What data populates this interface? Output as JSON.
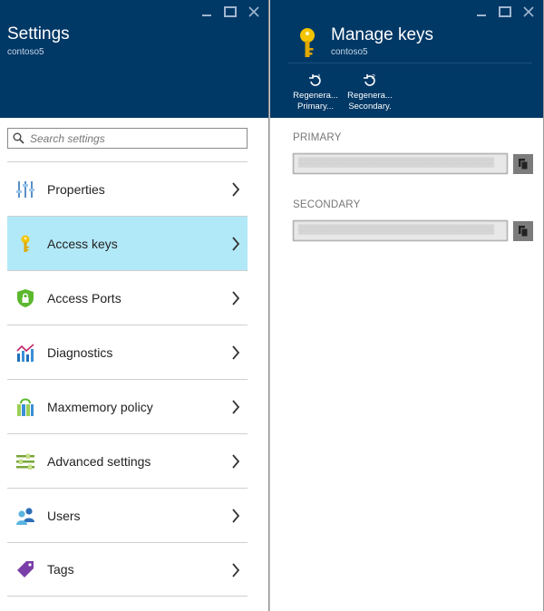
{
  "settings": {
    "title": "Settings",
    "subtitle": "contoso5",
    "search_placeholder": "Search settings",
    "items": [
      {
        "label": "Properties",
        "icon": "properties-icon"
      },
      {
        "label": "Access keys",
        "icon": "key-icon",
        "selected": true
      },
      {
        "label": "Access Ports",
        "icon": "shield-lock-icon"
      },
      {
        "label": "Diagnostics",
        "icon": "diagnostics-chart-icon"
      },
      {
        "label": "Maxmemory policy",
        "icon": "maxmemory-icon"
      },
      {
        "label": "Advanced settings",
        "icon": "advanced-settings-icon"
      },
      {
        "label": "Users",
        "icon": "users-icon"
      },
      {
        "label": "Tags",
        "icon": "tag-icon"
      }
    ]
  },
  "keys": {
    "title": "Manage keys",
    "subtitle": "contoso5",
    "commands": [
      {
        "line1": "Regenera...",
        "line2": "Primary...",
        "icon": "regenerate-1-icon"
      },
      {
        "line1": "Regenera...",
        "line2": "Secondary.",
        "icon": "regenerate-2-icon"
      }
    ],
    "primary_label": "PRIMARY",
    "secondary_label": "SECONDARY"
  },
  "colors": {
    "header": "#003866",
    "selected": "#b2e9f8",
    "key_yellow": "#f4c400"
  }
}
